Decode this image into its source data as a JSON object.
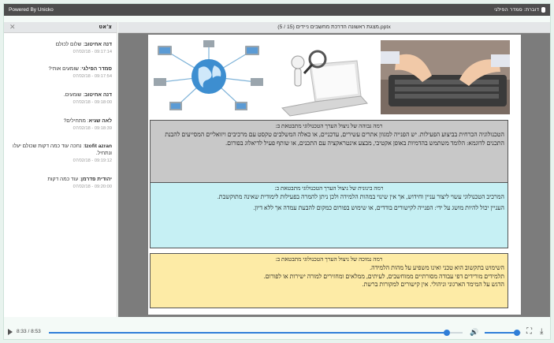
{
  "topbar": {
    "speaker": "דוברת: סמדר הפילגי",
    "powered": "Powered By Unicko"
  },
  "chat": {
    "title": "צ'אט",
    "messages": [
      {
        "name": "דנה אחיטוב",
        "text": "שלום לכולם",
        "time": "07/02/18 - 09:17:14"
      },
      {
        "name": "סמדר הפילגי",
        "text": "שומעים אותי?",
        "time": "07/02/18 - 09:17:54"
      },
      {
        "name": "דנה אחיטוב",
        "text": "שומעים.",
        "time": "07/02/18 - 09:18:00"
      },
      {
        "name": "לאה שגיא",
        "text": "מתחילים?",
        "time": "07/02/18 - 09:18:39"
      },
      {
        "name": "tzofit azran",
        "text": "נחכה עוד כמה דקות שכולם יעלו ונתחיל.",
        "time": "07/02/18 - 09:19:12"
      },
      {
        "name": "יהודית פדרמן",
        "text": "עוד כמה דקות",
        "time": "07/02/18 - 09:20:00"
      }
    ]
  },
  "presentation": {
    "title": "(5 / 15) מצגת ראשונה הדרכת מחשבים ניידים.pptx",
    "box1": {
      "heading": "רמה גבוהה של ניצול הערך הטכנולוגי מתבטאת ב:",
      "text": "הטכנולוגיה הכרחית בביצוע הפעילות. יש הפנייה למגוון אתרים עשירים, עדכניים, או כאלה המשלבים טקסט עם מרכיבים ויזואליים המסייעים להבנת התכנים לדוגמא: הלומד משתמש בהדמיות באופן אקטיבי, מבצע אינטראקציה עם התכנים, או שותף פעיל לדיאלוג בפורום."
    },
    "box2": {
      "heading": "רמה בינונית של ניצול הערך הטכנולוגי מתבטאת ב:",
      "text1": "המרכיב הטכנולוגי עשוי ליצור עניין וחידוש, אך אין שינוי במהות הלמידה ולכן ניתן להמרה בפעילות לימודית שאינה מתוקשבת.",
      "text2": "העניין יכול להיות מושג על ידי: הפנייה לקישורים בודדים, או שימוש בפורום כמקום להבעת עמדה אך ללא דיון."
    },
    "box3": {
      "heading": "רמה נמוכה של ניצול הערך הטכנולוגי מתבטאת ב:",
      "text1": "השימוש בתקשוב הוא טכני ואינו משפיע על מהות הלמידה.",
      "text2": "תלמידים מורידים דפי עבודה מסורתיים ממוחשבים, לעיתים, ממלאים ומחזירים למורה ישירות או לפורום.",
      "text3": "הדגש על המימד הארגוני וניהולי. אין קישורים למקורות ברשת."
    }
  },
  "player": {
    "time": "8:33 / 8:53",
    "progress": 0.962,
    "volume": 0.9,
    "colors": {
      "accent": "#2f7ed8"
    }
  }
}
